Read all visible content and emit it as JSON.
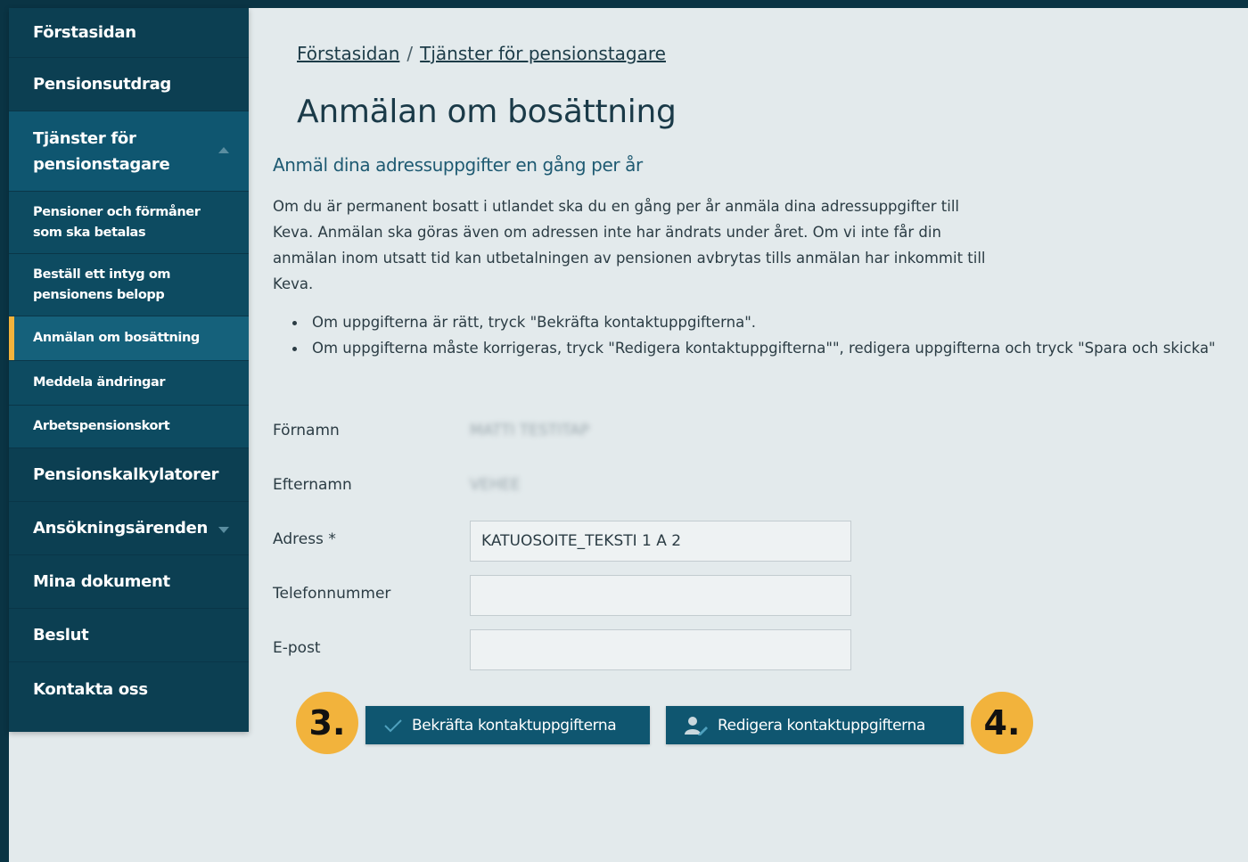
{
  "sidebar": {
    "items": [
      {
        "label": "Förstasidan"
      },
      {
        "label": "Pensionsutdrag"
      },
      {
        "label": "Tjänster för pensionstagare"
      },
      {
        "label": "Pensioner och förmåner som ska betalas"
      },
      {
        "label": "Beställ ett intyg om pensionens belopp"
      },
      {
        "label": "Anmälan om bosättning"
      },
      {
        "label": "Meddela ändringar"
      },
      {
        "label": "Arbetspensionskort"
      },
      {
        "label": "Pensionskalkylatorer"
      },
      {
        "label": "Ansökningsärenden"
      },
      {
        "label": "Mina dokument"
      },
      {
        "label": "Beslut"
      },
      {
        "label": "Kontakta oss"
      }
    ]
  },
  "breadcrumb": {
    "home": "Förstasidan",
    "separator": "/",
    "current": "Tjänster för pensionstagare"
  },
  "page": {
    "title": "Anmälan om bosättning",
    "subtitle": "Anmäl dina adressuppgifter en gång per år",
    "intro": "Om du är permanent bosatt i utlandet ska du en gång per år anmäla dina adressuppgifter till Keva. Anmälan ska göras även om adressen inte har ändrats under året. Om vi inte får din anmälan inom utsatt tid kan utbetalningen av pensionen avbrytas tills anmälan har inkommit till Keva.",
    "bullets": [
      "Om uppgifterna är rätt, tryck \"Bekräfta kontaktuppgifterna\".",
      "Om uppgifterna måste korrigeras, tryck \"Redigera kontaktuppgifterna\"\", redigera uppgifterna och tryck \"Spara och skicka\""
    ]
  },
  "form": {
    "first_name_label": "Förnamn",
    "first_name_value": "MATTI TESTITAP",
    "last_name_label": "Efternamn",
    "last_name_value": "VEHEE",
    "address_label": "Adress *",
    "address_value": "KATUOSOITE_TEKSTI 1 A 2",
    "phone_label": "Telefonnummer",
    "phone_value": "",
    "email_label": "E-post",
    "email_value": ""
  },
  "actions": {
    "confirm_label": "Bekräfta kontaktuppgifterna",
    "edit_label": "Redigera kontaktuppgifterna",
    "badge_left": "3.",
    "badge_right": "4."
  },
  "colors": {
    "nav_bg": "#0c3f52",
    "nav_section": "#0f5670",
    "accent": "#f2b33c",
    "button": "#0f5670",
    "content_bg": "#e3eaec"
  }
}
